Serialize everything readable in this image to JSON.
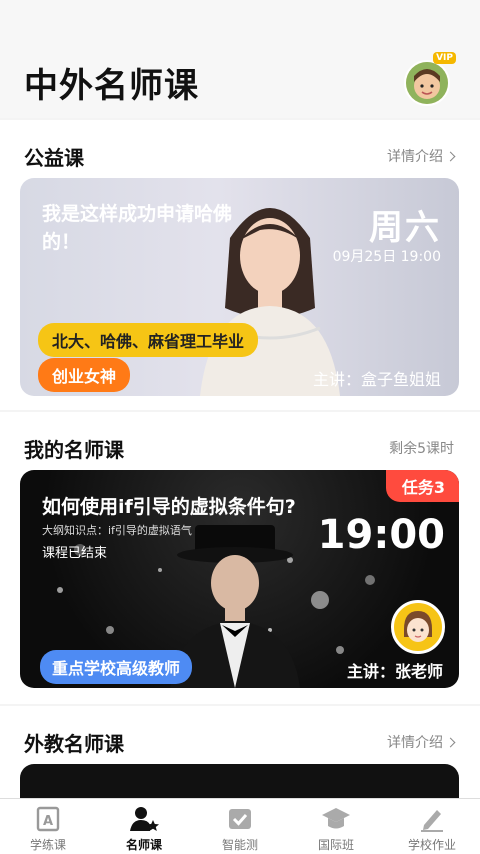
{
  "header": {
    "title": "中外名师课",
    "vip_label": "VIP"
  },
  "public_course": {
    "title": "公益课",
    "link_label": "详情介绍",
    "card": {
      "headline": "我是这样成功申请哈佛的！",
      "day": "周六",
      "date": "09月25日 19:00",
      "tag_primary": "北大、哈佛、麻省理工毕业",
      "tag_secondary": "创业女神",
      "speaker": "主讲：盒子鱼姐姐"
    }
  },
  "my_course": {
    "title": "我的名师课",
    "remaining": "剩余5课时",
    "card": {
      "task_badge": "任务3",
      "title": "如何使用if引导的虚拟条件句?",
      "subtitle": "大纲知识点：if引导的虚拟语气",
      "status": "课程已结束",
      "time": "19:00",
      "tag": "重点学校高级教师",
      "speaker": "主讲：张老师"
    }
  },
  "foreign_course": {
    "title": "外教名师课",
    "link_label": "详情介绍"
  },
  "tabbar": {
    "items": [
      {
        "label": "学练课",
        "icon": "a-letter-icon",
        "active": false
      },
      {
        "label": "名师课",
        "icon": "teacher-star-icon",
        "active": true
      },
      {
        "label": "智能测",
        "icon": "check-icon",
        "active": false
      },
      {
        "label": "国际班",
        "icon": "grad-cap-icon",
        "active": false
      },
      {
        "label": "学校作业",
        "icon": "pencil-icon",
        "active": false
      }
    ]
  },
  "colors": {
    "accent_yellow": "#f6c515",
    "accent_orange": "#ff7a16",
    "task_red": "#ff4b3e",
    "tag_blue": "#4e8bf3"
  }
}
